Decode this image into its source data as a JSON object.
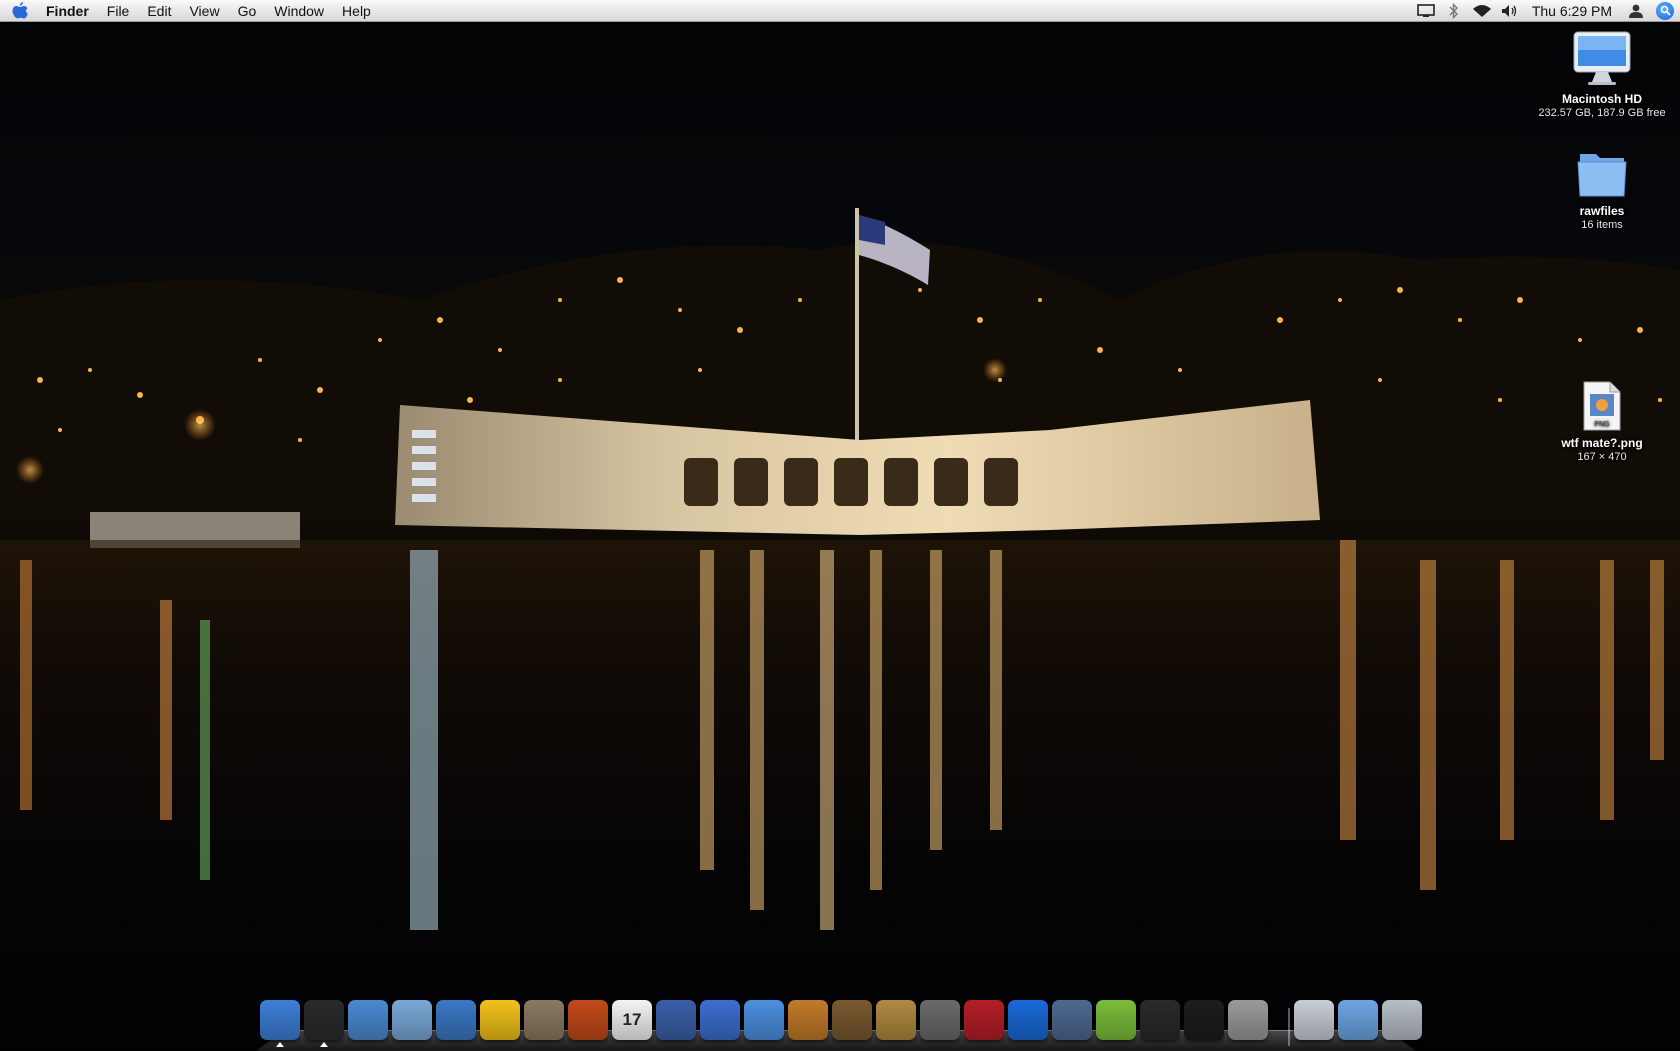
{
  "menubar": {
    "app_name": "Finder",
    "menus": [
      "File",
      "Edit",
      "View",
      "Go",
      "Window",
      "Help"
    ],
    "clock": "Thu 6:29 PM",
    "status_icons": [
      "display-icon",
      "bluetooth-icon",
      "wifi-icon",
      "volume-icon",
      "user-icon",
      "spotlight-icon"
    ]
  },
  "desktop_icons": [
    {
      "label": "Macintosh HD",
      "info": "232.57 GB, 187.9 GB free",
      "icon": "hard-drive-icon"
    },
    {
      "label": "rawfiles",
      "info": "16 items",
      "icon": "folder-icon"
    },
    {
      "label": "wtf mate?.png",
      "info": "167 × 470",
      "icon": "png-file-icon",
      "badge": "PNG"
    }
  ],
  "dock": {
    "apps": [
      {
        "name": "finder-icon",
        "color": "#3d7fd8"
      },
      {
        "name": "dashboard-icon",
        "color": "#2b2b2b"
      },
      {
        "name": "safari-icon",
        "color": "#4a8ad0"
      },
      {
        "name": "mail-icon",
        "color": "#7aa9d8"
      },
      {
        "name": "ichat-icon",
        "color": "#3b78c4"
      },
      {
        "name": "adium-duck-icon",
        "color": "#f2c21a"
      },
      {
        "name": "gimp-icon",
        "color": "#8a7a60"
      },
      {
        "name": "photo-booth-icon",
        "color": "#c24a1a"
      },
      {
        "name": "ical-icon",
        "color": "#f4f4f4",
        "text": "17"
      },
      {
        "name": "imovie-icon",
        "color": "#3a5fa8"
      },
      {
        "name": "dvd-player-icon",
        "color": "#3c6fd0"
      },
      {
        "name": "itunes-icon",
        "color": "#4d8fe0"
      },
      {
        "name": "garageband-icon",
        "color": "#c27a2a"
      },
      {
        "name": "iphoto-icon",
        "color": "#7a5a30"
      },
      {
        "name": "preview-icon",
        "color": "#b08a40"
      },
      {
        "name": "x11-icon",
        "color": "#6a6a6a"
      },
      {
        "name": "photo-slideshow-icon",
        "color": "#b41e28"
      },
      {
        "name": "quicktime-icon",
        "color": "#1a6ad8"
      },
      {
        "name": "system-profiler-icon",
        "color": "#4c6a90"
      },
      {
        "name": "stuffit-icon",
        "color": "#7bbd3a"
      },
      {
        "name": "activity-monitor-icon",
        "color": "#2a2a2a"
      },
      {
        "name": "terminal-icon",
        "color": "#1c1c1c"
      },
      {
        "name": "system-preferences-icon",
        "color": "#9a9a9a"
      },
      {
        "name": "home-folder-icon",
        "color": "#c9cfd6"
      },
      {
        "name": "documents-folder-icon",
        "color": "#6da6e4"
      },
      {
        "name": "trash-icon",
        "color": "#b8bec6"
      }
    ]
  }
}
